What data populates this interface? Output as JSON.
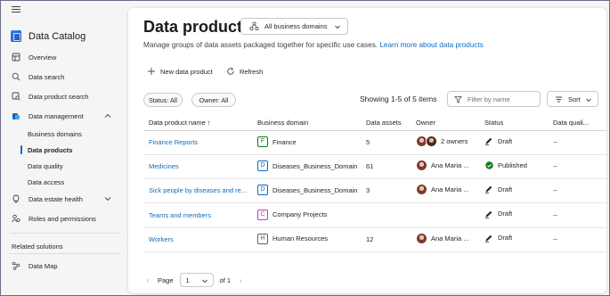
{
  "sidebar": {
    "app_title": "Data Catalog",
    "items": [
      {
        "label": "Overview",
        "icon": "map-icon"
      },
      {
        "label": "Data search",
        "icon": "search-icon"
      },
      {
        "label": "Data product search",
        "icon": "product-search-icon"
      },
      {
        "label": "Data management",
        "icon": "briefcase-icon"
      },
      {
        "label": "Data estate health",
        "icon": "lightbulb-icon"
      },
      {
        "label": "Roles and permissions",
        "icon": "people-settings-icon"
      }
    ],
    "sub_items": [
      {
        "label": "Business domains",
        "active": false
      },
      {
        "label": "Data products",
        "active": true
      },
      {
        "label": "Data quality",
        "active": false
      },
      {
        "label": "Data access",
        "active": false
      }
    ],
    "related_label": "Related solutions",
    "related_items": [
      {
        "label": "Data Map",
        "icon": "data-map-icon"
      }
    ]
  },
  "header": {
    "title": "Data products",
    "domain_filter": "All business domains",
    "subtitle": "Manage groups of data assets packaged together for specific use cases.",
    "learn_more": "Learn more about data products"
  },
  "toolbar": {
    "new_label": "New data product",
    "refresh_label": "Refresh"
  },
  "filters": {
    "status_pill": "Status: All",
    "owner_pill": "Owner: All",
    "showing": "Showing 1-5 of 5 items",
    "filter_placeholder": "Filter by name",
    "sort_label": "Sort"
  },
  "table": {
    "columns": [
      "Data product name ↑",
      "Business domain",
      "Data assets",
      "Owner",
      "Status",
      "Data quali..."
    ],
    "rows": [
      {
        "name": "Finance Reports",
        "domain_letter": "F",
        "domain": "Finance",
        "domain_color": "#107c10",
        "assets": "5",
        "owner": "2 owners",
        "avatars": 2,
        "status": "Draft",
        "status_type": "draft",
        "quality": "--"
      },
      {
        "name": "Medicines",
        "domain_letter": "D",
        "domain": "Diseases_Business_Domain",
        "domain_color": "#0f6cbd",
        "assets": "61",
        "owner": "Ana Maria ...",
        "avatars": 1,
        "status": "Published",
        "status_type": "published",
        "quality": "--"
      },
      {
        "name": "Sick people by diseases and re...",
        "domain_letter": "D",
        "domain": "Diseases_Business_Domain",
        "domain_color": "#0f6cbd",
        "assets": "3",
        "owner": "Ana Maria ...",
        "avatars": 1,
        "status": "Draft",
        "status_type": "draft",
        "quality": "--"
      },
      {
        "name": "Teams and members",
        "domain_letter": "C",
        "domain": "Company Projects",
        "domain_color": "#c239b3",
        "assets": "",
        "owner": "",
        "avatars": 0,
        "status": "Draft",
        "status_type": "draft",
        "quality": "--"
      },
      {
        "name": "Workers",
        "domain_letter": "H",
        "domain": "Human Resources",
        "domain_color": "#616161",
        "assets": "12",
        "owner": "Ana Maria ...",
        "avatars": 1,
        "status": "Draft",
        "status_type": "draft",
        "quality": "--"
      }
    ]
  },
  "pagination": {
    "page_label": "Page",
    "current_page": "1",
    "of_label": "of 1"
  },
  "colors": {
    "accent": "#0f6cbd",
    "published": "#107c10"
  }
}
